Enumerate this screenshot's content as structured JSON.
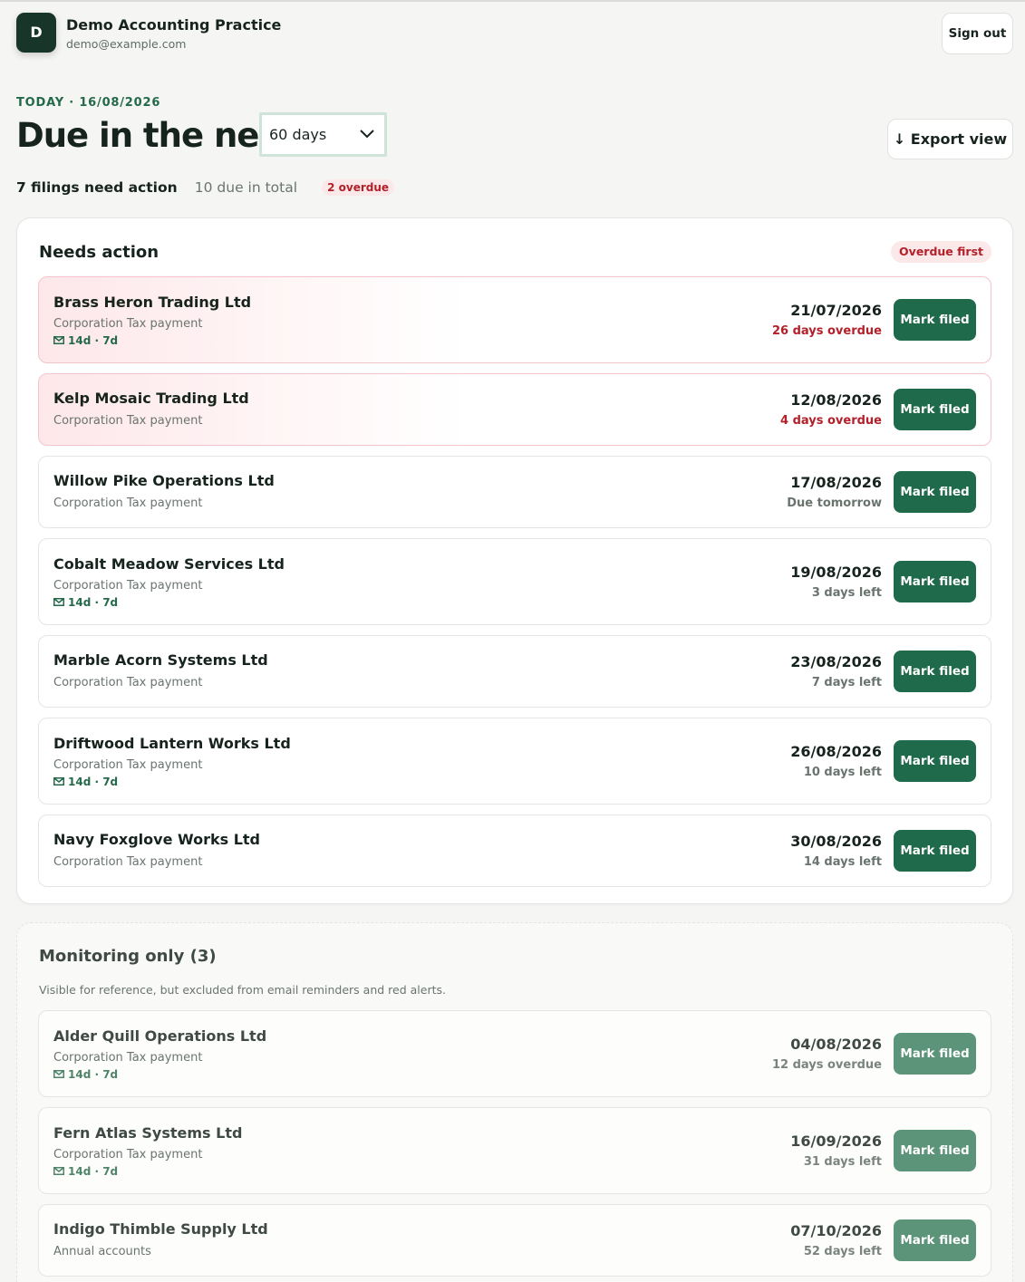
{
  "header": {
    "avatar_letter": "D",
    "org_name": "Demo Accounting Practice",
    "email": "demo@example.com",
    "sign_out": "Sign out"
  },
  "toolbar": {
    "today": "TODAY · 16/08/2026",
    "title": "Due in the next",
    "period_value": "60 days",
    "export_label": "↓ Export view"
  },
  "summary": {
    "need_action": "7 filings need action",
    "total": "10 due in total",
    "overdue": "2 overdue"
  },
  "needs_action": {
    "title": "Needs action",
    "sort_label": "Overdue first",
    "rows": [
      {
        "client": "Brass Heron Trading Ltd",
        "type": "Corporation Tax payment",
        "reminder": "14d · 7d",
        "date": "21/07/2026",
        "relative": "26 days overdue",
        "overdue": true,
        "button": "Mark filed"
      },
      {
        "client": "Kelp Mosaic Trading Ltd",
        "type": "Corporation Tax payment",
        "reminder": "",
        "date": "12/08/2026",
        "relative": "4 days overdue",
        "overdue": true,
        "button": "Mark filed"
      },
      {
        "client": "Willow Pike Operations Ltd",
        "type": "Corporation Tax payment",
        "reminder": "",
        "date": "17/08/2026",
        "relative": "Due tomorrow",
        "overdue": false,
        "button": "Mark filed"
      },
      {
        "client": "Cobalt Meadow Services Ltd",
        "type": "Corporation Tax payment",
        "reminder": "14d · 7d",
        "date": "19/08/2026",
        "relative": "3 days left",
        "overdue": false,
        "button": "Mark filed"
      },
      {
        "client": "Marble Acorn Systems Ltd",
        "type": "Corporation Tax payment",
        "reminder": "",
        "date": "23/08/2026",
        "relative": "7 days left",
        "overdue": false,
        "button": "Mark filed"
      },
      {
        "client": "Driftwood Lantern Works Ltd",
        "type": "Corporation Tax payment",
        "reminder": "14d · 7d",
        "date": "26/08/2026",
        "relative": "10 days left",
        "overdue": false,
        "button": "Mark filed"
      },
      {
        "client": "Navy Foxglove Works Ltd",
        "type": "Corporation Tax payment",
        "reminder": "",
        "date": "30/08/2026",
        "relative": "14 days left",
        "overdue": false,
        "button": "Mark filed"
      }
    ]
  },
  "monitoring": {
    "title": "Monitoring only (3)",
    "description": "Visible for reference, but excluded from email reminders and red alerts.",
    "rows": [
      {
        "client": "Alder Quill Operations Ltd",
        "type": "Corporation Tax payment",
        "reminder": "14d · 7d",
        "date": "04/08/2026",
        "relative": "12 days overdue",
        "button": "Mark filed"
      },
      {
        "client": "Fern Atlas Systems Ltd",
        "type": "Corporation Tax payment",
        "reminder": "14d · 7d",
        "date": "16/09/2026",
        "relative": "31 days left",
        "button": "Mark filed"
      },
      {
        "client": "Indigo Thimble Supply Ltd",
        "type": "Annual accounts",
        "reminder": "",
        "date": "07/10/2026",
        "relative": "52 days left",
        "button": "Mark filed"
      }
    ]
  },
  "colors": {
    "brand": "#173528",
    "accent_green": "#1f6a4b",
    "overdue_red": "#b3202a",
    "overdue_pill_bg": "#fbe9ea"
  },
  "icons": {
    "reminder": "mail-icon",
    "select": "chevron-down-icon"
  }
}
